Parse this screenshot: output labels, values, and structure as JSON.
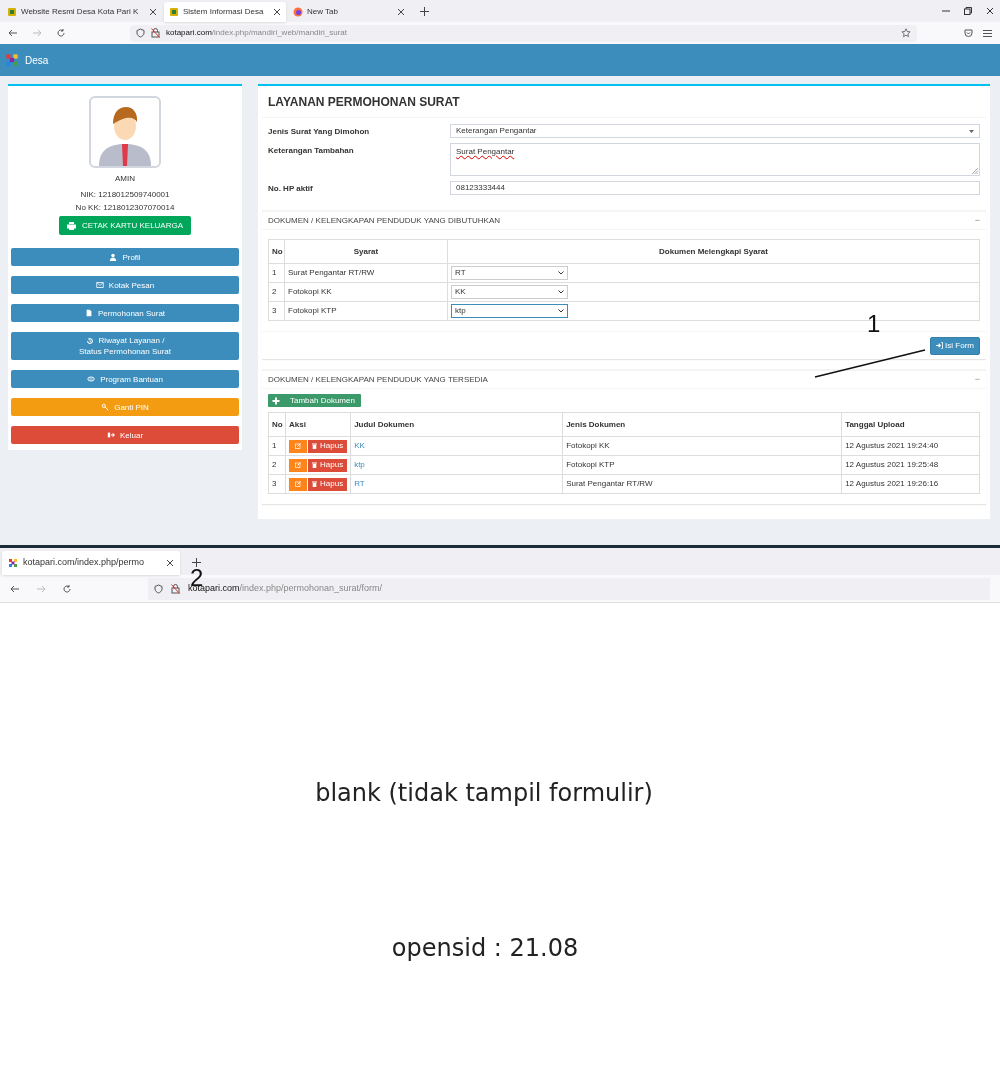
{
  "browser_top": {
    "tabs": [
      {
        "title": "Website Resmi Desa Kota Pari K",
        "selected": false
      },
      {
        "title": "Sistem Informasi Desa",
        "selected": true
      },
      {
        "title": "New Tab",
        "selected": false
      }
    ],
    "url_host": "kotapari.com",
    "url_path": "/index.php/mandiri_web/mandiri_surat"
  },
  "app_header": {
    "title": "Desa"
  },
  "profile": {
    "name": "AMIN",
    "nik": "NIK: 1218012509740001",
    "kk": "No KK: 1218012307070014",
    "print_button": "CETAK KARTU KELUARGA"
  },
  "menu": [
    {
      "lines": [
        "Profil"
      ],
      "color": "#3c8dbc"
    },
    {
      "lines": [
        "Kotak Pesan"
      ],
      "color": "#3c8dbc"
    },
    {
      "lines": [
        "Permohonan Surat"
      ],
      "color": "#3c8dbc"
    },
    {
      "lines": [
        "Riwayat Layanan /",
        "Status Permohonan Surat"
      ],
      "color": "#3c8dbc"
    },
    {
      "lines": [
        "Program Bantuan"
      ],
      "color": "#3c8dbc"
    },
    {
      "lines": [
        "Ganti PIN"
      ],
      "color": "#f39c12"
    },
    {
      "lines": [
        "Keluar"
      ],
      "color": "#dd4b39"
    }
  ],
  "form": {
    "title": "LAYANAN PERMOHONAN SURAT",
    "fields": [
      {
        "label": "Jenis Surat Yang Dimohon",
        "kind": "select",
        "value": "Keterangan Pengantar"
      },
      {
        "label": "Keterangan Tambahan",
        "kind": "textarea",
        "value": "Surat Pengantar"
      },
      {
        "label": "No. HP aktif",
        "kind": "input",
        "value": "08123333444"
      }
    ]
  },
  "required_docs": {
    "title": "DOKUMEN / KELENGKAPAN PENDUDUK YANG DIBUTUHKAN",
    "collapse_symbol": "−",
    "columns": [
      "No",
      "Syarat",
      "Dokumen Melengkapi Syarat"
    ],
    "rows": [
      {
        "no": "1",
        "syarat": "Surat Pengantar RT/RW",
        "document": "RT",
        "focused": false
      },
      {
        "no": "2",
        "syarat": "Fotokopi KK",
        "document": "KK",
        "focused": false
      },
      {
        "no": "3",
        "syarat": "Fotokopi KTP",
        "document": "ktp",
        "focused": true
      }
    ],
    "submit_button": "Isi Form"
  },
  "available_docs": {
    "title": "DOKUMEN / KELENGKAPAN PENDUDUK YANG TERSEDIA",
    "collapse_symbol": "−",
    "add_button": "Tambah Dokumen",
    "columns": [
      "No",
      "Aksi",
      "Judul Dokumen",
      "Jenis Dokumen",
      "Tanggal Upload"
    ],
    "rows": [
      {
        "no": "1",
        "delete_label": "Hapus",
        "title": "KK",
        "type": "Fotokopi KK",
        "uploaded": "12 Agustus 2021 19:24:40"
      },
      {
        "no": "2",
        "delete_label": "Hapus",
        "title": "ktp",
        "type": "Fotokopi KTP",
        "uploaded": "12 Agustus 2021 19:25:48"
      },
      {
        "no": "3",
        "delete_label": "Hapus",
        "title": "RT",
        "type": "Surat Pengantar RT/RW",
        "uploaded": "12 Agustus 2021 19:26:16"
      }
    ]
  },
  "browser_bottom": {
    "tabs": [
      {
        "title": "kotapari.com/index.php/permo",
        "selected": true
      }
    ],
    "url_host": "kotapari.com",
    "url_path": "/index.php/permohonan_surat/form/"
  },
  "notes": [
    "blank (tidak tampil formulir)",
    "opensid : 21.08"
  ],
  "annotations": [
    {
      "label": "1"
    },
    {
      "label": "2"
    }
  ]
}
